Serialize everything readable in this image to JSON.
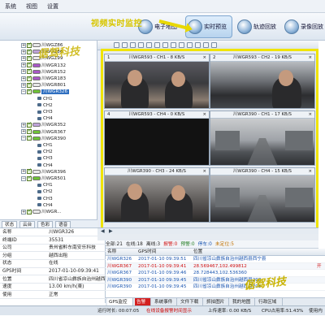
{
  "menu": [
    "系统",
    "视图",
    "设置"
  ],
  "annotation": {
    "overlay_title": "视频实时监控",
    "watermark": "倨驾科技"
  },
  "toolbar": {
    "buttons": [
      {
        "label": "电子地图",
        "active": false
      },
      {
        "label": "实时预览",
        "active": true
      },
      {
        "label": "轨迹回放",
        "active": false
      },
      {
        "label": "录像回放",
        "active": false
      }
    ]
  },
  "tree": [
    {
      "label": "川WGZ86",
      "level": 0,
      "car_color": "#e8e8e8"
    },
    {
      "label": "川WGZ86",
      "level": 0,
      "car_color": "#bfa3d9"
    },
    {
      "label": "川WGZ99",
      "level": 0,
      "car_color": "#e8e8e8"
    },
    {
      "label": "川WGR132",
      "level": 0,
      "car_color": "#a857c6"
    },
    {
      "label": "川WGR152",
      "level": 0,
      "car_color": "#a857c6"
    },
    {
      "label": "川WGR183",
      "level": 0,
      "car_color": "#a857c6"
    },
    {
      "label": "川WGR801",
      "level": 0,
      "car_color": "#e8e8e8"
    },
    {
      "label": "川WGR326",
      "level": 0,
      "car_color": "#6fc236",
      "selected": true
    },
    {
      "label": "CH1",
      "level": 1
    },
    {
      "label": "CH2",
      "level": 1
    },
    {
      "label": "CH3",
      "level": 1
    },
    {
      "label": "CH4",
      "level": 1
    },
    {
      "label": "川WGR352",
      "level": 0,
      "car_color": "#bfa3d9"
    },
    {
      "label": "川WGR367",
      "level": 0,
      "car_color": "#6fc236"
    },
    {
      "label": "川WGR390",
      "level": 0,
      "car_color": "#6fc236"
    },
    {
      "label": "CH1",
      "level": 1
    },
    {
      "label": "CH2",
      "level": 1
    },
    {
      "label": "CH3",
      "level": 1
    },
    {
      "label": "CH4",
      "level": 1
    },
    {
      "label": "川WGR396",
      "level": 0,
      "car_color": "#e8e8e8"
    },
    {
      "label": "川WGR501",
      "level": 0,
      "car_color": "#6fc236"
    },
    {
      "label": "CH1",
      "level": 1
    },
    {
      "label": "CH2",
      "level": 1
    },
    {
      "label": "CH3",
      "level": 1
    },
    {
      "label": "CH4",
      "level": 1
    },
    {
      "label": "川WGR...",
      "level": 0,
      "car_color": "#e8e8e8"
    }
  ],
  "left_tabs": [
    "状态",
    "云台",
    "色彩",
    "语音"
  ],
  "info": [
    {
      "k": "名称",
      "v": "川WGR326"
    },
    {
      "k": "终端ID",
      "v": "35531"
    },
    {
      "k": "公司",
      "v": "贵州省黔东南安乐科技"
    },
    {
      "k": "分组",
      "v": "越西出租"
    },
    {
      "k": "状态",
      "v": "在线"
    },
    {
      "k": "GPS时间",
      "v": "2017-01-10-09:39:41"
    },
    {
      "k": "位置",
      "v": "四川省凉山彝族自治州越西"
    },
    {
      "k": "速度",
      "v": "13.00 km/h(東)"
    },
    {
      "k": "使用",
      "v": "正常"
    }
  ],
  "video_cells": [
    {
      "index": "1",
      "caption": "川WGR593 - CH1 - 8 KB/S",
      "scene": "s1"
    },
    {
      "index": "2",
      "caption": "川WGR593 - CH2 - 19 KB/S",
      "scene": "s2"
    },
    {
      "index": "4",
      "caption": "川WGR593 - CH4 - 0 KB/S",
      "scene": "blank"
    },
    {
      "index": "",
      "caption": "川WGR390 - CH1 - 17 KB/S",
      "scene": "s4"
    },
    {
      "index": "",
      "caption": "川WGR390 - CH3 - 24 KB/S",
      "scene": "s5"
    },
    {
      "index": "",
      "caption": "川WGR390 - CH4 - 15 KB/S",
      "scene": "s6"
    }
  ],
  "counts": [
    {
      "label": "全部:21",
      "color": "#222"
    },
    {
      "label": "在线:18",
      "color": "#222"
    },
    {
      "label": "离线:3",
      "color": "#222"
    },
    {
      "label": "报警:0",
      "color": "#d01010"
    },
    {
      "label": "预警:0",
      "color": "#1f7a1f"
    },
    {
      "label": "停车:0",
      "color": "#1a55b0"
    },
    {
      "label": "未定位:5",
      "color": "#c07000"
    }
  ],
  "events": {
    "headers": [
      "名称",
      "GPS时间",
      "位置"
    ],
    "rows": [
      {
        "name": "川WGR326",
        "time": "2017-01-10 09:39:51",
        "loc": "四川省凉山彝族自治州越西县西宁县",
        "flag": "",
        "red": false
      },
      {
        "name": "川WGR367",
        "time": "2017-01-10 09:39:41",
        "loc": "28.569467,102.499812",
        "flag": "开",
        "red": true
      },
      {
        "name": "川WGR367",
        "time": "2017-01-10 09:39:46",
        "loc": "28.728443,102.536360",
        "flag": "",
        "red": false
      },
      {
        "name": "川WGR390",
        "time": "2017-01-10 09:39:45",
        "loc": "四川省凉山彝族自治州越西县208",
        "flag": "",
        "red": false
      },
      {
        "name": "川WGR390",
        "time": "2017-01-10 09:39:45",
        "loc": "四川省凉山彝族自治州越西县208",
        "flag": "",
        "red": false
      }
    ]
  },
  "bottom_tabs": [
    {
      "label": "GPS监控",
      "state": "on"
    },
    {
      "label": "告警",
      "state": "hot"
    },
    {
      "label": "系统事件",
      "state": ""
    },
    {
      "label": "文件下载",
      "state": ""
    },
    {
      "label": "抓拍图片",
      "state": ""
    },
    {
      "label": "我的地图",
      "state": ""
    },
    {
      "label": "行政区域",
      "state": ""
    }
  ],
  "statusbar": {
    "runtime": "运行时长: 00:07:05",
    "alarm": "在线设备报警时间显示",
    "upload": "上传速率: 0.00 KB/S",
    "cpu": "CPU占用率:51.43%",
    "extra": "使用内"
  }
}
